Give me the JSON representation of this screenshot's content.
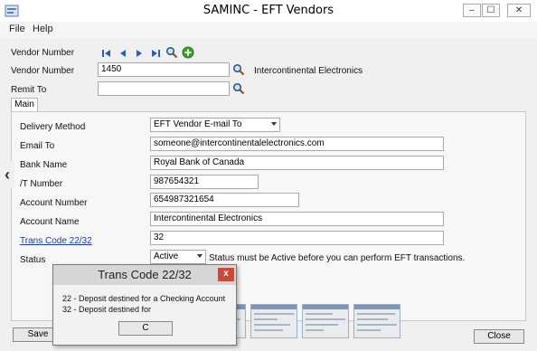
{
  "window": {
    "title": "SAMINC - EFT Vendors",
    "min_label": "–",
    "max_label": "☐",
    "close_label": "✕"
  },
  "menu": {
    "file": "File",
    "help": "Help"
  },
  "header": {
    "vendor_number_nav_label": "Vendor Number",
    "vendor_number_label": "Vendor Number",
    "vendor_number_value": "1450",
    "vendor_name": "Intercontinental Electronics",
    "remit_to_label": "Remit To",
    "remit_to_value": ""
  },
  "tabs": [
    {
      "label": "Main"
    }
  ],
  "form": {
    "delivery_method_label": "Delivery Method",
    "delivery_method_value": "EFT Vendor E-mail To",
    "email_label": "Email To",
    "email_value": "someone@intercontinentalelectronics.com",
    "bank_name_label": "Bank Name",
    "bank_name_value": "Royal Bank of Canada",
    "transit_number_label": "/T Number",
    "transit_number_value": "987654321",
    "account_number_label": "Account Number",
    "account_number_value": "654987321654",
    "account_name_label": "Account Name",
    "account_name_value": "Intercontinental Electronics",
    "trans_code_label": "Trans Code 22/32",
    "trans_code_value": "32",
    "status_label": "Status",
    "status_value": "Active",
    "status_note": "Status must be Active before you can perform EFT transactions."
  },
  "buttons": {
    "save": "Save",
    "close": "Close"
  },
  "dialog": {
    "title": "Trans Code 22/32",
    "line1": "22 - Deposit destined for a Checking Account",
    "line2": "32 - Deposit destined for",
    "button": "C",
    "close_label": "x"
  },
  "colors": {
    "link": "#1a3a9a",
    "dialog_close": "#c84a3a",
    "nav_arrows": "#2a5fb0",
    "add_icon": "#3aa02a"
  }
}
